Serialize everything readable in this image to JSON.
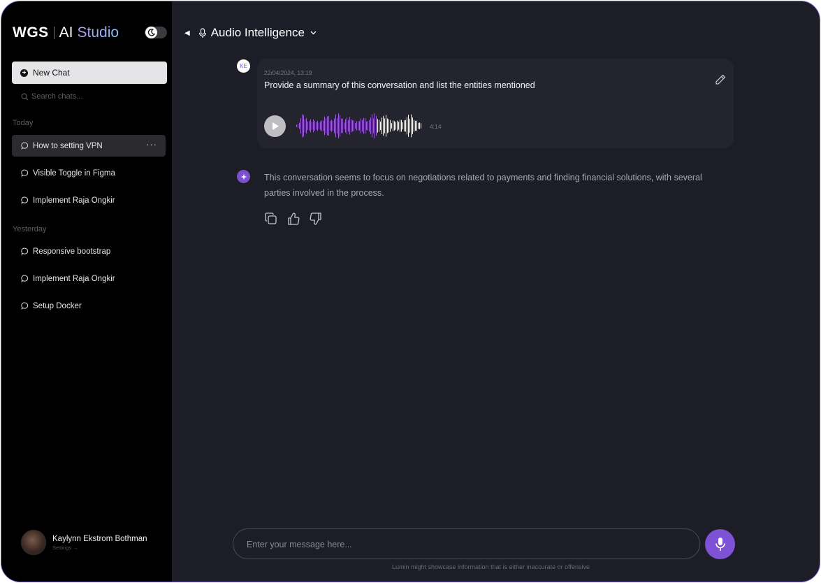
{
  "brand": {
    "wgs": "WGS",
    "ai": "AI",
    "studio": "Studio"
  },
  "sidebar": {
    "new_chat_label": "New Chat",
    "search_placeholder": "Search chats...",
    "sections": [
      {
        "label": "Today",
        "items": [
          "How to setting VPN",
          "Visible Toggle in Figma",
          "Implement Raja Ongkir"
        ]
      },
      {
        "label": "Yesterday",
        "items": [
          "Responsive bootstrap",
          "Implement Raja Ongkir",
          "Setup Docker"
        ]
      }
    ],
    "active_item_more": "···"
  },
  "profile": {
    "name": "Kaylynn Ekstrom Bothman",
    "settings": "Settings →"
  },
  "header": {
    "title": "Audio Intelligence"
  },
  "conversation": {
    "user_initials": "KE",
    "user_message": {
      "timestamp": "22/04/2024, 13:19",
      "text": "Provide a summary of this conversation and list the entities mentioned",
      "audio_duration": "4:14",
      "playback_progress": 0.64
    },
    "ai_message": {
      "text": "This conversation seems to focus on negotiations related to payments and finding financial solutions, with several parties involved in the process."
    }
  },
  "composer": {
    "placeholder": "Enter your message here...",
    "disclaimer": "Lumin might showcase information that is either inaccurate or offensive"
  },
  "colors": {
    "accent": "#7d52d4",
    "sidebar_bg": "#000000",
    "main_bg": "#1c1d26",
    "card_bg": "#23242e",
    "wave_played": "#9a5fd6",
    "wave_unplayed": "#ffffff"
  },
  "icons": {
    "theme_toggle": "moon-icon",
    "chat": "chat-bubble-icon",
    "edit": "pencil-icon",
    "play": "play-icon",
    "copy": "copy-icon",
    "like": "thumbs-up-icon",
    "dislike": "thumbs-down-icon",
    "mic": "microphone-icon"
  }
}
